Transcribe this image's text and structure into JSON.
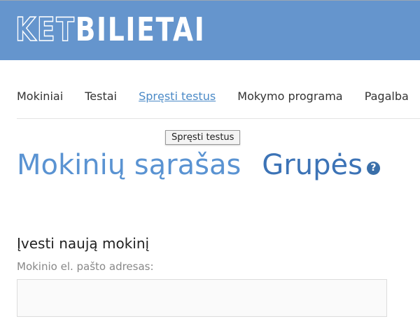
{
  "logo": {
    "outline_part": "KET",
    "solid_part": "BILIETAI"
  },
  "nav": {
    "items": [
      {
        "label": "Mokiniai"
      },
      {
        "label": "Testai"
      },
      {
        "label": "Spręsti testus",
        "active": true
      },
      {
        "label": "Mokymo programa"
      },
      {
        "label": "Pagalba"
      }
    ]
  },
  "tooltip": {
    "text": "Spręsti testus"
  },
  "main": {
    "tabs": [
      {
        "label": "Mokinių sąrašas"
      },
      {
        "label": "Grupės"
      }
    ],
    "help_icon": {
      "glyph": "?",
      "name": "help-icon"
    }
  },
  "form": {
    "title": "Įvesti naują mokinį",
    "email_label": "Mokinio el. pašto adresas:",
    "email_value": ""
  },
  "colors": {
    "header_bg": "#6595cd",
    "link_active": "#4b8ac7",
    "title_primary": "#5a93d2",
    "title_secondary": "#3c73b6"
  }
}
